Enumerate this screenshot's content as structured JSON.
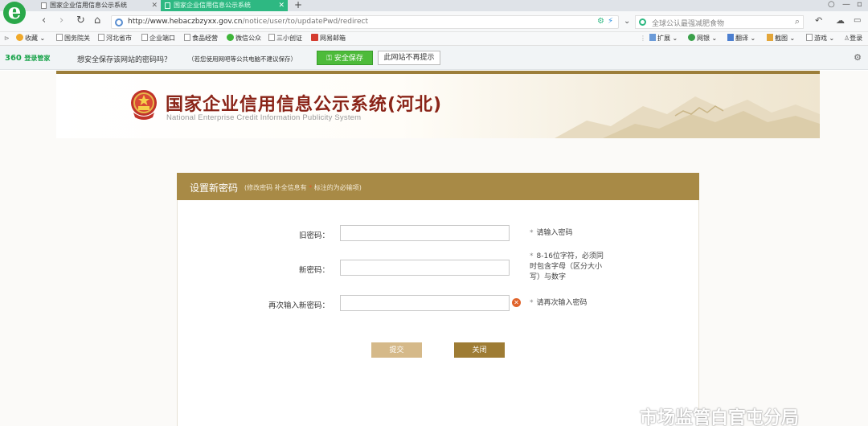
{
  "browser": {
    "tabs": [
      {
        "title": "国家企业信用信息公示系统",
        "active": false
      },
      {
        "title": "国家企业信用信息公示系统",
        "active": true
      }
    ],
    "new_tab": "+",
    "url_host": "http://www.hebaczbzyxx.gov.cn",
    "url_path": "/notice/user/to/updatePwd/redirect",
    "search_placeholder": "全球公认最强减肥食物",
    "bookmarks": [
      "收藏",
      "国务院关",
      "河北省市",
      "企业端口",
      "食品经营",
      "微信公众",
      "三小创证",
      "网易邮箱"
    ],
    "bookmarks_right": [
      "扩展",
      "网银",
      "翻译",
      "截图",
      "游戏",
      "登录"
    ],
    "accent": "#2eb882"
  },
  "notice_bar": {
    "brand": "360",
    "brand_tag": "登录管家",
    "question": "想安全保存该网站的密码吗？",
    "tip": "（若您使用网吧等公共电脑不建议保存）",
    "save_button": "安全保存",
    "dismiss_button": "此网站不再提示"
  },
  "site": {
    "title": "国家企业信用信息公示系统(河北)",
    "subtitle": "National Enterprise Credit Information Publicity System"
  },
  "form": {
    "header": "设置新密码",
    "hint_prefix": "(修改密码 补全信息有",
    "hint_suffix": "标注的为必输项)",
    "fields": [
      {
        "label": "旧密码：",
        "value": "",
        "hint": "请输入密码"
      },
      {
        "label": "新密码：",
        "value": "",
        "hint": "8-16位字符，必须同时包含字母（区分大小写）与数字"
      },
      {
        "label": "再次输入新密码：",
        "value": "",
        "hint": "请再次输入密码",
        "error": true
      }
    ],
    "submit_button": "提交",
    "close_button": "关闭"
  },
  "watermark": "市场监管白官屯分局"
}
